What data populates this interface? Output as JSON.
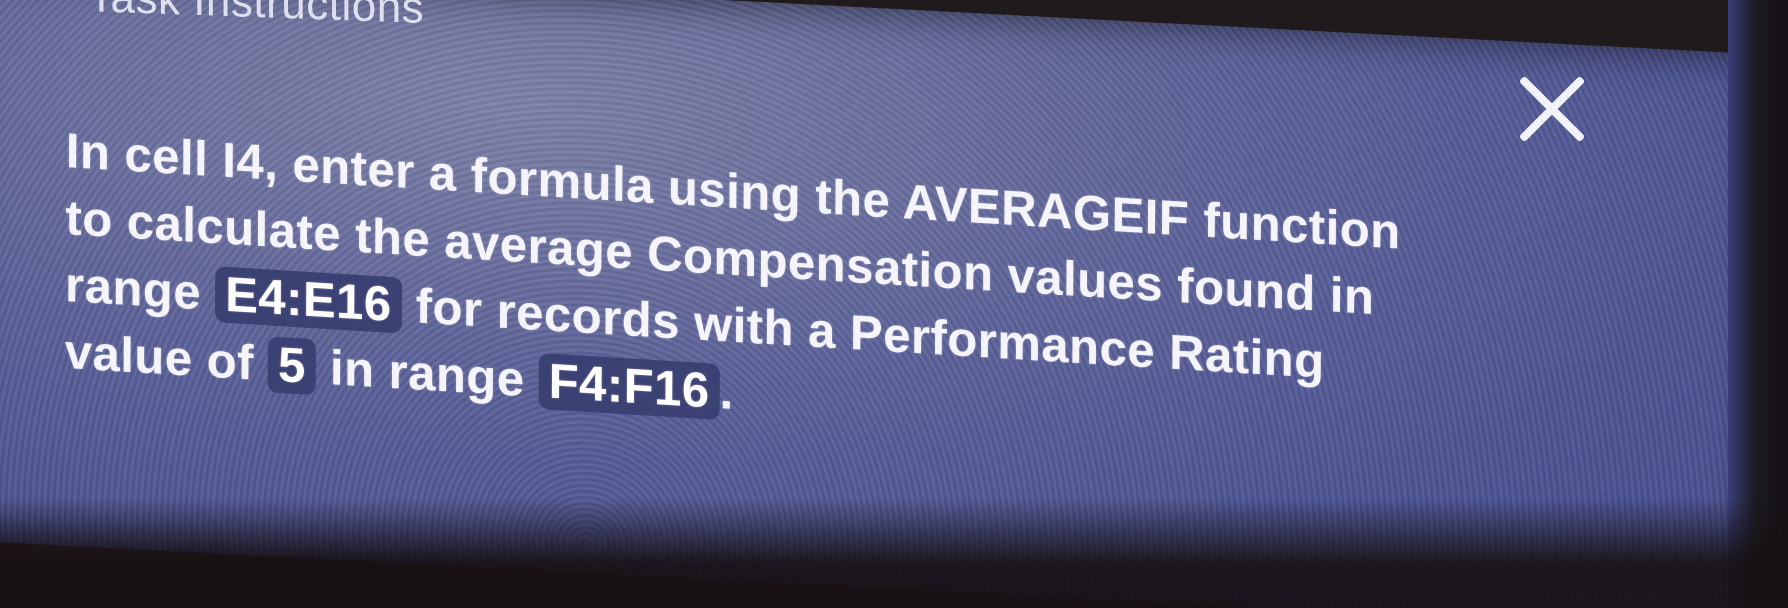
{
  "dialog": {
    "title": "Task Instructions",
    "close_label": "×"
  },
  "instruction": {
    "line1": "In cell I4, enter a formula using the AVERAGEIF function",
    "line2": "to calculate the average Compensation values found in",
    "line3_prefix": "range",
    "line3_range": "E4:E16",
    "line3_suffix": "for records with a Performance Rating",
    "line4_prefix": "value of",
    "line4_value": "5",
    "line4_mid": "in range",
    "line4_range": "F4:F16",
    "line4_end": "."
  },
  "colors": {
    "panel": "#4d5493",
    "code_chip": "#3c4174",
    "text": "#f4f4fa"
  }
}
